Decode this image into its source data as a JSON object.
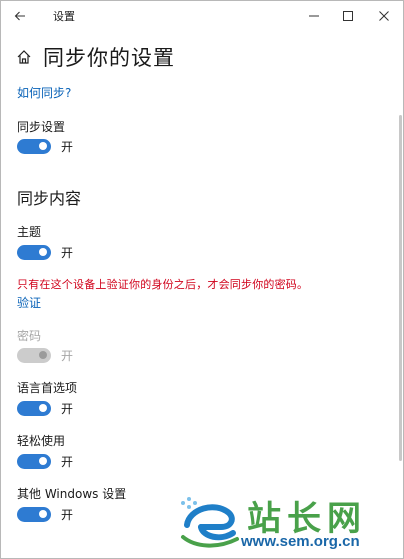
{
  "window": {
    "app_title": "设置",
    "page_title": "同步你的设置",
    "controls": {
      "back": "back-arrow-icon",
      "minimize": "minimize-icon",
      "maximize": "maximize-icon",
      "close": "close-icon"
    }
  },
  "content": {
    "how_to_sync_link": "如何同步?",
    "sync_settings": {
      "label": "同步设置",
      "state": "开"
    },
    "section_heading": "同步内容",
    "theme": {
      "label": "主题",
      "state": "开"
    },
    "warning_text": "只有在这个设备上验证你的身份之后，才会同步你的密码。",
    "verify_link": "验证",
    "password": {
      "label": "密码",
      "state": "开",
      "disabled": true
    },
    "language_preferences": {
      "label": "语言首选项",
      "state": "开"
    },
    "ease_of_access": {
      "label": "轻松使用",
      "state": "开"
    },
    "other_windows_settings": {
      "label": "其他 Windows 设置",
      "state": "开"
    }
  },
  "watermark": {
    "title": "站长网",
    "url": "www.sem.org.cn"
  },
  "colors": {
    "accent": "#2e7bd2",
    "link": "#0a63b8",
    "warning": "#d0021b",
    "disabled": "#a6a6a6",
    "watermark_green": "#49a14a",
    "watermark_blue": "#1a67a8"
  }
}
